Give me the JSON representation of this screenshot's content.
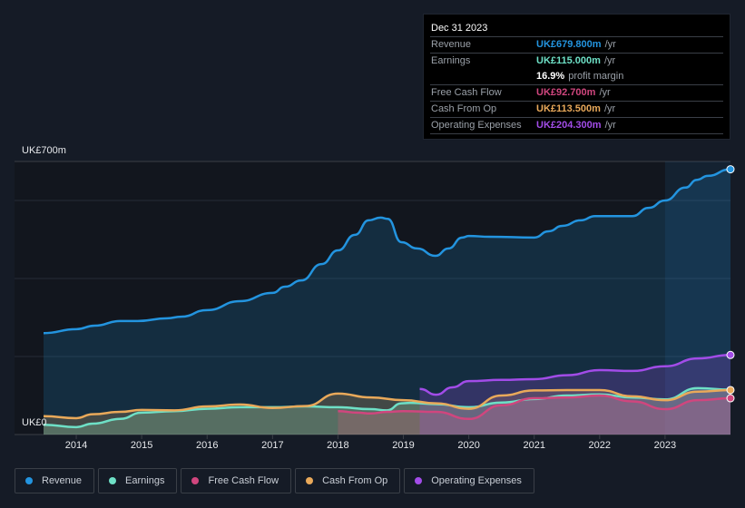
{
  "tooltip": {
    "date": "Dec 31 2023",
    "rows": [
      {
        "label": "Revenue",
        "value": "UK£679.800m",
        "unit": "/yr",
        "color": "#2394df"
      },
      {
        "label": "Earnings",
        "value": "UK£115.000m",
        "unit": "/yr",
        "color": "#6ee0c6"
      },
      {
        "label": "",
        "value": "16.9%",
        "unit": "profit margin",
        "color": "#ffffff"
      },
      {
        "label": "Free Cash Flow",
        "value": "UK£92.700m",
        "unit": "/yr",
        "color": "#d0467e"
      },
      {
        "label": "Cash From Op",
        "value": "UK£113.500m",
        "unit": "/yr",
        "color": "#e9a95a"
      },
      {
        "label": "Operating Expenses",
        "value": "UK£204.300m",
        "unit": "/yr",
        "color": "#a24ce8"
      }
    ]
  },
  "chart_data": {
    "type": "area",
    "title": "",
    "xlabel": "",
    "ylabel": "",
    "y_top_label": "UK£700m",
    "y_bottom_label": "UK£0",
    "ylim": [
      0,
      700
    ],
    "xlim": [
      2013.5,
      2024.0
    ],
    "grid": true,
    "highlight_from": 2023.0,
    "x_ticks": [
      "2014",
      "2015",
      "2016",
      "2017",
      "2018",
      "2019",
      "2020",
      "2021",
      "2022",
      "2023"
    ],
    "legend_position": "bottom-left",
    "series": [
      {
        "name": "Revenue",
        "color": "#2394df",
        "x": [
          2013.5,
          2014.0,
          2014.28,
          2014.67,
          2014.94,
          2015.39,
          2015.6,
          2016.0,
          2016.5,
          2017.0,
          2017.19,
          2017.44,
          2017.75,
          2018.0,
          2018.26,
          2018.47,
          2018.65,
          2018.76,
          2018.97,
          2019.21,
          2019.49,
          2019.69,
          2019.9,
          2020.0,
          2020.32,
          2021.0,
          2021.22,
          2021.43,
          2021.71,
          2021.93,
          2022.5,
          2022.75,
          2023.0,
          2023.31,
          2023.49,
          2023.65,
          2024.0
        ],
        "values": [
          260,
          270,
          279,
          291,
          291,
          298,
          302,
          319,
          342,
          363,
          379,
          395,
          437,
          472,
          512,
          549,
          556,
          553,
          493,
          477,
          458,
          477,
          505,
          509,
          507,
          505,
          521,
          535,
          549,
          560,
          560,
          581,
          600,
          633,
          653,
          663,
          680
        ]
      },
      {
        "name": "Earnings",
        "color": "#6ee0c6",
        "x": [
          2013.5,
          2014.0,
          2014.25,
          2014.67,
          2015.0,
          2015.5,
          2016.0,
          2016.5,
          2017.0,
          2017.5,
          2018.0,
          2018.5,
          2018.75,
          2018.97,
          2019.1,
          2019.5,
          2020.0,
          2020.5,
          2021.0,
          2021.5,
          2022.0,
          2022.5,
          2023.0,
          2023.5,
          2024.0
        ],
        "values": [
          25,
          19,
          28,
          40,
          56,
          60,
          66,
          70,
          70,
          72,
          70,
          65,
          62,
          80,
          81,
          78,
          70,
          82,
          91,
          100,
          103,
          95,
          90,
          119,
          115
        ]
      },
      {
        "name": "Free Cash Flow",
        "color": "#d0467e",
        "x": [
          2018.0,
          2018.3,
          2018.5,
          2018.75,
          2019.0,
          2019.5,
          2020.0,
          2020.5,
          2021.0,
          2021.5,
          2022.0,
          2022.5,
          2023.0,
          2023.5,
          2024.0
        ],
        "values": [
          60,
          56,
          54,
          58,
          60,
          58,
          40,
          75,
          93,
          95,
          100,
          85,
          65,
          88,
          93
        ]
      },
      {
        "name": "Cash From Op",
        "color": "#e9a95a",
        "x": [
          2013.5,
          2014.0,
          2014.25,
          2014.67,
          2015.0,
          2015.5,
          2016.0,
          2016.5,
          2017.0,
          2017.5,
          2018.0,
          2018.5,
          2019.0,
          2019.5,
          2020.0,
          2020.5,
          2021.0,
          2021.5,
          2022.0,
          2022.5,
          2023.0,
          2023.5,
          2024.0
        ],
        "values": [
          47,
          42,
          52,
          58,
          63,
          62,
          72,
          77,
          68,
          73,
          105,
          95,
          88,
          80,
          66,
          100,
          113,
          114,
          114,
          98,
          88,
          110,
          114
        ]
      },
      {
        "name": "Operating Expenses",
        "color": "#a24ce8",
        "x": [
          2019.25,
          2019.5,
          2019.75,
          2020.0,
          2020.5,
          2021.0,
          2021.5,
          2022.0,
          2022.5,
          2023.0,
          2023.5,
          2024.0
        ],
        "values": [
          117,
          102,
          121,
          137,
          140,
          142,
          152,
          165,
          163,
          175,
          195,
          204
        ]
      }
    ]
  },
  "legend": [
    {
      "label": "Revenue",
      "color": "#2394df"
    },
    {
      "label": "Earnings",
      "color": "#6ee0c6"
    },
    {
      "label": "Free Cash Flow",
      "color": "#d0467e"
    },
    {
      "label": "Cash From Op",
      "color": "#e9a95a"
    },
    {
      "label": "Operating Expenses",
      "color": "#a24ce8"
    }
  ]
}
